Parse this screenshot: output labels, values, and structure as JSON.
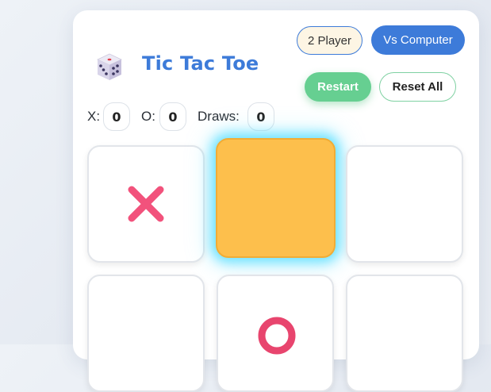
{
  "header": {
    "title": "Tic Tac Toe",
    "logo_icon": "dice-icon"
  },
  "mode": {
    "two_player_label": "2 Player",
    "vs_computer_label": "Vs Computer",
    "selected": "Vs Computer"
  },
  "actions": {
    "restart_label": "Restart",
    "reset_all_label": "Reset All"
  },
  "scores": {
    "x_label": "X:",
    "x_value": "0",
    "o_label": "O:",
    "o_value": "0",
    "draws_label": "Draws:",
    "draws_value": "0"
  },
  "board": {
    "cells": [
      "X",
      "",
      "",
      "",
      "O",
      ""
    ],
    "highlighted_cell": 1
  },
  "colors": {
    "accent": "#3d7bd9",
    "x_mark": "#f2527c",
    "o_mark": "#e8456e",
    "highlight": "#fdbf4c",
    "glow": "#50dcff",
    "restart": "#66cf91"
  }
}
